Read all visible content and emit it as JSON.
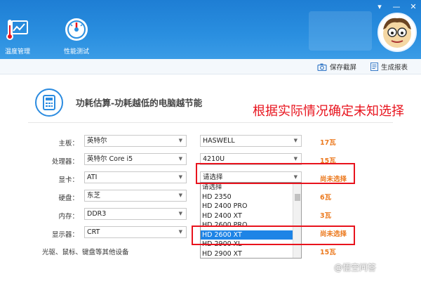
{
  "header": {
    "nav": [
      {
        "label": "温度管理"
      },
      {
        "label": "性能测试"
      }
    ],
    "window_controls": [
      "▾",
      "—",
      "✕"
    ]
  },
  "toolbar": {
    "save_screenshot": "保存截屏",
    "generate_report": "生成报表"
  },
  "main": {
    "title": "功耗估算-功耗越低的电脑越节能",
    "annotation": "根据实际情况确定未知选择",
    "rows": [
      {
        "label": "主板：",
        "brand": "英特尔",
        "model": "HASWELL",
        "watt": "17瓦"
      },
      {
        "label": "处理器：",
        "brand": "英特尔 Core i5",
        "model": "4210U",
        "watt": "15瓦"
      },
      {
        "label": "显卡：",
        "brand": "ATI",
        "model": "请选择",
        "watt": "尚未选择"
      },
      {
        "label": "硬盘：",
        "brand": "东芝",
        "model": "",
        "watt": "6瓦"
      },
      {
        "label": "内存：",
        "brand": "DDR3",
        "model": "",
        "watt": "3瓦"
      },
      {
        "label": "显示器：",
        "brand": "CRT",
        "model": "",
        "watt": "尚未选择"
      }
    ],
    "other_label": "光驱、鼠标、键盘等其他设备",
    "other_watt": "15瓦",
    "dropdown_options": [
      "请选择",
      "HD 2350",
      "HD 2400 PRO",
      "HD 2400 XT",
      "HD 2600 PRO",
      "HD 2600 XT",
      "HD 2900 XL",
      "HD 2900 XT"
    ],
    "dropdown_selected_index": 5
  },
  "watermark": "@悟空问答",
  "colors": {
    "header_blue": "#2a8fe0",
    "accent_red": "#e8131d",
    "watt_orange": "#ec7a1f",
    "select_highlight": "#1e84e6"
  }
}
